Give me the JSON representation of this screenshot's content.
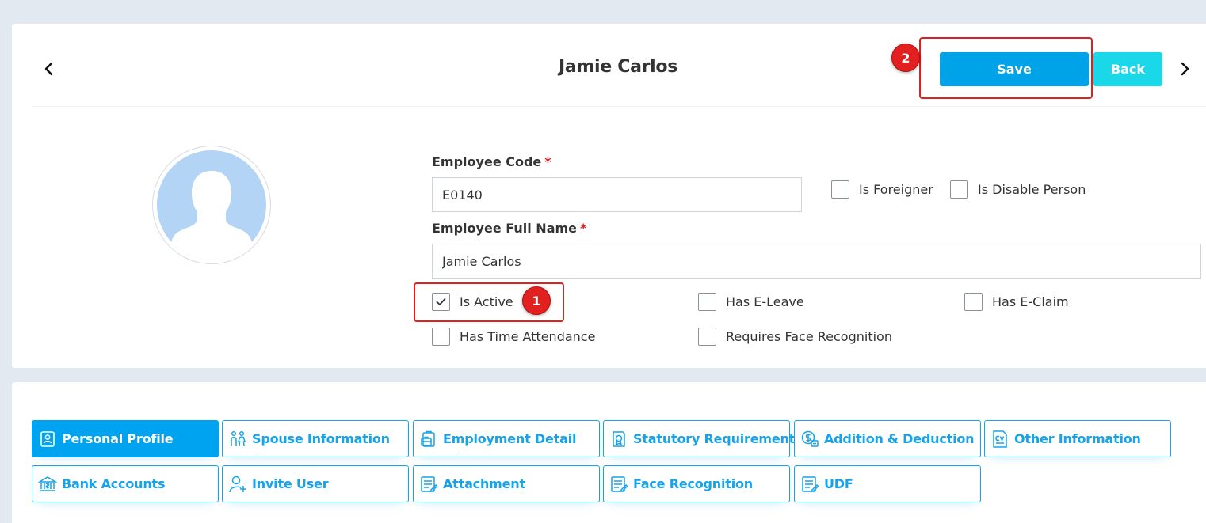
{
  "header": {
    "title": "Jamie Carlos",
    "save_label": "Save",
    "back_label": "Back",
    "prev_icon": "chevron-left-icon",
    "next_icon": "chevron-right-icon"
  },
  "form": {
    "employee_code_label": "Employee Code",
    "employee_code_value": "E0140",
    "full_name_label": "Employee Full Name",
    "full_name_value": "Jamie Carlos",
    "required_mark": "*",
    "checkboxes": {
      "is_foreigner": {
        "label": "Is Foreigner",
        "checked": false
      },
      "is_disable_person": {
        "label": "Is Disable Person",
        "checked": false
      },
      "is_active": {
        "label": "Is Active",
        "checked": true
      },
      "has_e_leave": {
        "label": "Has E-Leave",
        "checked": false
      },
      "has_e_claim": {
        "label": "Has E-Claim",
        "checked": false
      },
      "has_time_attendance": {
        "label": "Has Time Attendance",
        "checked": false
      },
      "requires_face_recognition": {
        "label": "Requires Face Recognition",
        "checked": false
      }
    }
  },
  "annotations": {
    "badge_1": "1",
    "badge_2": "2",
    "color": "#e32020"
  },
  "tabs": [
    {
      "label": "Personal Profile",
      "icon": "profile-card-icon",
      "active": true
    },
    {
      "label": "Spouse Information",
      "icon": "couple-icon",
      "active": false
    },
    {
      "label": "Employment Detail",
      "icon": "briefcase-doc-icon",
      "active": false
    },
    {
      "label": "Statutory Requirement",
      "icon": "certificate-icon",
      "active": false
    },
    {
      "label": "Addition & Deduction",
      "icon": "money-icon",
      "active": false
    },
    {
      "label": "Other Information",
      "icon": "cv-icon",
      "active": false
    },
    {
      "label": "Bank Accounts",
      "icon": "bank-icon",
      "active": false
    },
    {
      "label": "Invite User",
      "icon": "add-user-icon",
      "active": false
    },
    {
      "label": "Attachment",
      "icon": "document-icon",
      "active": false
    },
    {
      "label": "Face Recognition",
      "icon": "document-icon",
      "active": false
    },
    {
      "label": "UDF",
      "icon": "document-icon",
      "active": false
    }
  ],
  "colors": {
    "primary": "#00a3e8",
    "secondary": "#1ad8e8",
    "tab_accent": "#16a3ea",
    "avatar_bg": "#b3d4f5"
  }
}
